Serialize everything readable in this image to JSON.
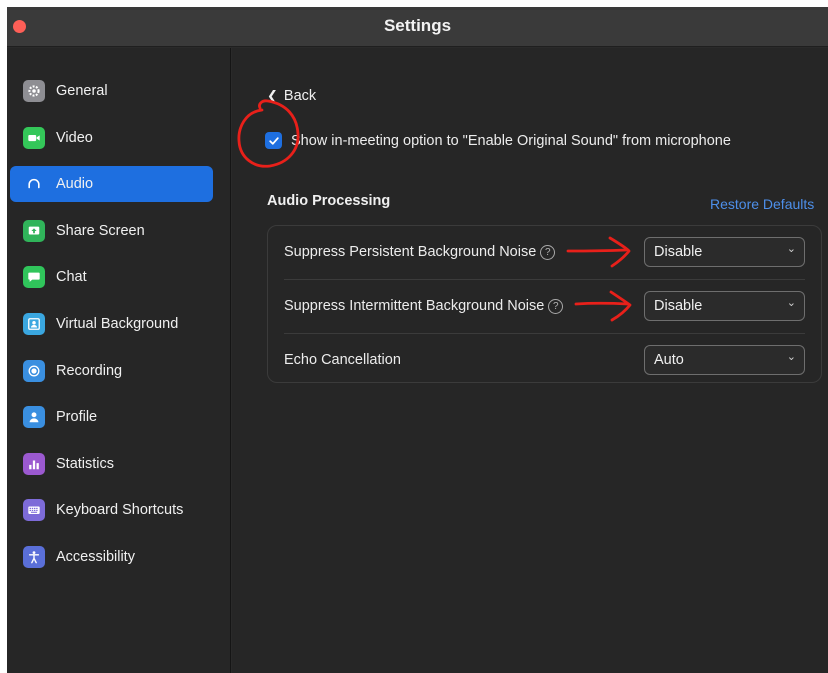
{
  "window": {
    "title": "Settings"
  },
  "sidebar": {
    "items": [
      {
        "label": "General",
        "icon": "gear-icon",
        "color": "#8e8e93"
      },
      {
        "label": "Video",
        "icon": "video-camera-icon",
        "color": "#34c759"
      },
      {
        "label": "Audio",
        "icon": "headphones-icon",
        "color": "#1e6fe0",
        "active": true
      },
      {
        "label": "Share Screen",
        "icon": "share-screen-icon",
        "color": "#30b45a"
      },
      {
        "label": "Chat",
        "icon": "chat-bubble-icon",
        "color": "#30c55b"
      },
      {
        "label": "Virtual Background",
        "icon": "person-frame-icon",
        "color": "#3aa7e0"
      },
      {
        "label": "Recording",
        "icon": "record-icon",
        "color": "#3a8fe0"
      },
      {
        "label": "Profile",
        "icon": "user-icon",
        "color": "#3a8fe0"
      },
      {
        "label": "Statistics",
        "icon": "bar-chart-icon",
        "color": "#9b59d0"
      },
      {
        "label": "Keyboard Shortcuts",
        "icon": "keyboard-icon",
        "color": "#7d6bd8"
      },
      {
        "label": "Accessibility",
        "icon": "accessibility-icon",
        "color": "#5a6fd8"
      }
    ]
  },
  "main": {
    "back_label": "Back",
    "original_sound": {
      "checked": true,
      "label": "Show in-meeting option to \"Enable Original Sound\" from microphone"
    },
    "audio_processing": {
      "title": "Audio Processing",
      "restore_label": "Restore Defaults",
      "rows": [
        {
          "label": "Suppress Persistent Background Noise",
          "help": true,
          "value": "Disable"
        },
        {
          "label": "Suppress Intermittent Background Noise",
          "help": true,
          "value": "Disable"
        },
        {
          "label": "Echo Cancellation",
          "help": false,
          "value": "Auto"
        }
      ]
    }
  },
  "colors": {
    "accent": "#1e6fe0",
    "link": "#4d8fea",
    "annotation": "#e8201a",
    "close_button": "#fe5f57"
  }
}
